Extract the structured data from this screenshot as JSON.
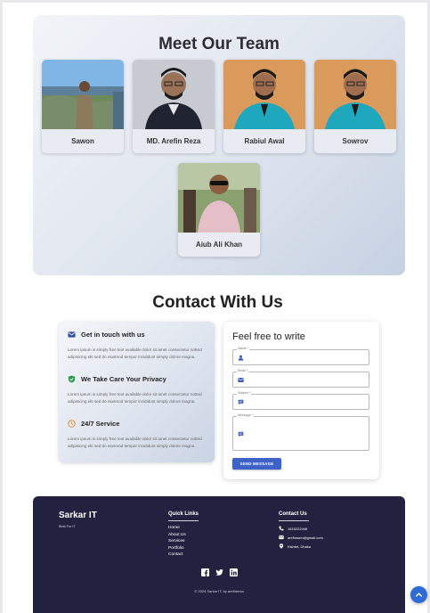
{
  "team": {
    "title": "Meet Our Team",
    "members": [
      {
        "name": "Sawon"
      },
      {
        "name": "MD. Arefin Reza"
      },
      {
        "name": "Rabiul Awal"
      },
      {
        "name": "Sowrov"
      },
      {
        "name": "Aiub Ali Khan"
      }
    ]
  },
  "contact": {
    "title": "Contact With Us",
    "info": [
      {
        "icon": "mail-icon",
        "title": "Get in touch with us",
        "text": "Lorem ipsum is simply free text available dolor sit amet consectetur notted adipisicing elit sed do eiusmod tempor incididunt simply dolore magna."
      },
      {
        "icon": "shield-check-icon",
        "title": "We Take Care Your Privacy",
        "text": "Lorem ipsum is simply free text available dolor sit amet consectetur notted adipisicing elit sed do eiusmod tempor incididunt simply dolore magna."
      },
      {
        "icon": "clock-icon",
        "title": "24/7 Service",
        "text": "Lorem ipsum is simply free text available dolor sit amet consectetur notted adipisicing elit sed do eiusmod tempor incididunt simply dolore magna."
      }
    ],
    "form": {
      "title": "Feel free to write",
      "name_label": "Name *",
      "email_label": "Email *",
      "subject_label": "Subject *",
      "message_label": "Message *",
      "send_label": "SEND MESSAGE"
    }
  },
  "footer": {
    "brand": "Sarkar IT",
    "tagline": "Best For IT",
    "quick_links_title": "Quick Links",
    "links": [
      "Home",
      "About Us",
      "Services",
      "Portfolio",
      "Contact"
    ],
    "contact_title": "Contact Us",
    "phone": "1615222446",
    "email": "arefinsum@gmail.com",
    "location": "Kishtet, Dhaka",
    "copyright": "© 2024 Sarkar IT, by arefinreza"
  },
  "colors": {
    "accent": "#3d63c9",
    "footer_bg": "#222240",
    "scroll_top": "#2f6bd6"
  }
}
